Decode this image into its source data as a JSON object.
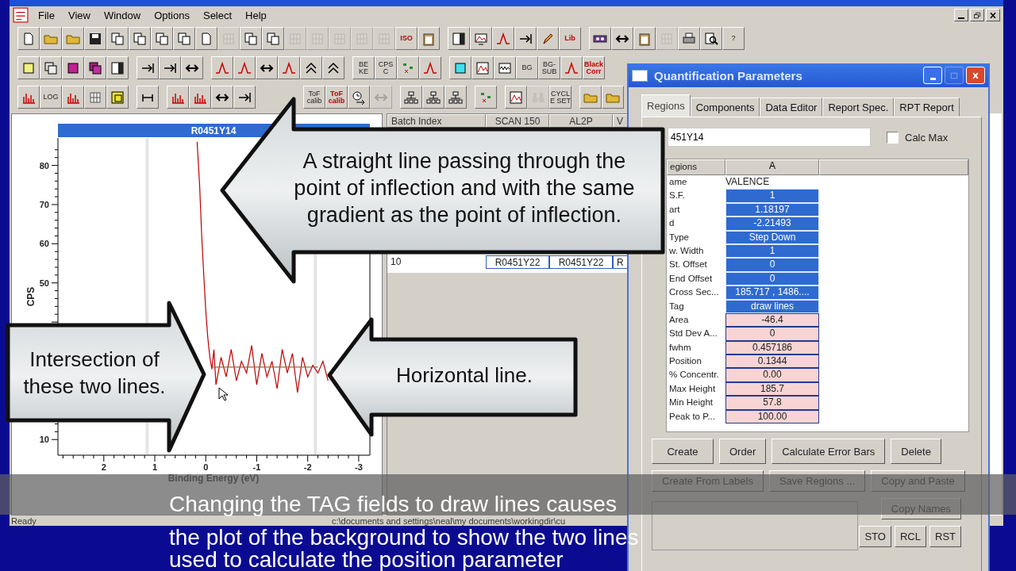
{
  "menu_bar": {
    "items": [
      "File",
      "View",
      "Window",
      "Options",
      "Select",
      "Help"
    ]
  },
  "toolbars": [
    [
      {
        "kind": "icon",
        "disabled": false
      },
      {
        "kind": "icon",
        "disabled": false
      },
      {
        "kind": "icon",
        "disabled": false
      },
      {
        "kind": "icon",
        "disabled": false
      },
      {
        "kind": "icon",
        "disabled": false
      },
      {
        "kind": "icon",
        "disabled": false
      },
      {
        "kind": "icon",
        "disabled": false
      },
      {
        "kind": "icon",
        "disabled": false
      },
      {
        "kind": "icon",
        "disabled": false
      },
      {
        "kind": "icon",
        "disabled": true
      },
      {
        "kind": "icon",
        "disabled": false
      },
      {
        "kind": "icon",
        "disabled": false
      },
      {
        "kind": "icon",
        "disabled": true
      },
      {
        "kind": "icon",
        "disabled": true
      },
      {
        "kind": "icon",
        "disabled": true
      },
      {
        "kind": "icon",
        "disabled": true
      },
      {
        "kind": "icon",
        "disabled": true
      },
      {
        "kind": "redlabel",
        "label": "ISO",
        "disabled": false
      },
      {
        "kind": "icon",
        "disabled": false
      },
      {
        "kind": "gap"
      },
      {
        "kind": "icon",
        "disabled": false
      },
      {
        "kind": "icon",
        "disabled": false
      },
      {
        "kind": "icon",
        "disabled": false
      },
      {
        "kind": "icon",
        "disabled": false
      },
      {
        "kind": "icon",
        "disabled": false
      },
      {
        "kind": "redlabel",
        "label": "Lib",
        "disabled": false
      },
      {
        "kind": "gap"
      },
      {
        "kind": "icon",
        "disabled": false
      },
      {
        "kind": "icon",
        "disabled": false
      },
      {
        "kind": "icon",
        "disabled": false
      },
      {
        "kind": "icon",
        "disabled": true
      },
      {
        "kind": "icon",
        "disabled": false
      },
      {
        "kind": "icon",
        "disabled": false
      },
      {
        "kind": "label",
        "label": "?",
        "disabled": false
      }
    ],
    [
      {
        "kind": "icon",
        "disabled": false
      },
      {
        "kind": "icon",
        "disabled": false
      },
      {
        "kind": "icon",
        "disabled": false
      },
      {
        "kind": "icon",
        "disabled": false
      },
      {
        "kind": "icon",
        "disabled": false
      },
      {
        "kind": "gap"
      },
      {
        "kind": "icon",
        "disabled": false
      },
      {
        "kind": "icon",
        "disabled": false
      },
      {
        "kind": "icon",
        "disabled": false
      },
      {
        "kind": "gap"
      },
      {
        "kind": "icon",
        "disabled": false
      },
      {
        "kind": "icon",
        "disabled": false
      },
      {
        "kind": "icon",
        "disabled": false
      },
      {
        "kind": "icon",
        "disabled": false
      },
      {
        "kind": "icon",
        "disabled": false
      },
      {
        "kind": "icon",
        "disabled": false
      },
      {
        "kind": "gap"
      },
      {
        "kind": "label",
        "label": "BE KE",
        "disabled": false
      },
      {
        "kind": "label",
        "label": "CPS C",
        "disabled": false
      },
      {
        "kind": "icon",
        "disabled": false
      },
      {
        "kind": "icon",
        "disabled": false
      },
      {
        "kind": "gap"
      },
      {
        "kind": "icon",
        "disabled": false
      },
      {
        "kind": "icon",
        "disabled": false
      },
      {
        "kind": "icon",
        "disabled": false
      },
      {
        "kind": "label",
        "label": "BG",
        "disabled": false
      },
      {
        "kind": "label",
        "label": "BG-SUB",
        "disabled": false
      },
      {
        "kind": "icon",
        "disabled": false
      },
      {
        "kind": "redlabel",
        "label": "Black Corr",
        "disabled": false
      }
    ],
    [
      {
        "kind": "icon",
        "disabled": false
      },
      {
        "kind": "label",
        "label": "LOG",
        "disabled": false
      },
      {
        "kind": "icon",
        "disabled": false
      },
      {
        "kind": "icon",
        "disabled": false
      },
      {
        "kind": "icon",
        "disabled": false
      },
      {
        "kind": "gap"
      },
      {
        "kind": "icon",
        "disabled": false
      },
      {
        "kind": "gap"
      },
      {
        "kind": "icon",
        "disabled": false
      },
      {
        "kind": "icon",
        "disabled": false
      },
      {
        "kind": "icon",
        "disabled": false
      },
      {
        "kind": "icon",
        "disabled": false
      },
      {
        "kind": "space"
      },
      {
        "kind": "label",
        "label": "ToF calib",
        "disabled": false
      },
      {
        "kind": "redlabel",
        "label": "ToF calib",
        "disabled": false
      },
      {
        "kind": "icon",
        "disabled": false
      },
      {
        "kind": "icon",
        "disabled": true
      },
      {
        "kind": "gap"
      },
      {
        "kind": "icon",
        "disabled": false
      },
      {
        "kind": "icon",
        "disabled": false
      },
      {
        "kind": "icon",
        "disabled": false
      },
      {
        "kind": "gap"
      },
      {
        "kind": "icon",
        "disabled": false
      },
      {
        "kind": "gap"
      },
      {
        "kind": "icon",
        "disabled": false
      },
      {
        "kind": "icon",
        "disabled": true
      },
      {
        "kind": "label",
        "label": "CYCLE SET",
        "disabled": false
      },
      {
        "kind": "gap"
      },
      {
        "kind": "icon",
        "disabled": false
      },
      {
        "kind": "icon",
        "disabled": false
      }
    ]
  ],
  "plot": {
    "title": "R0451Y14",
    "chart_data": {
      "type": "line",
      "xlabel": "Binding Energy (eV)",
      "ylabel": "CPS",
      "xlim": [
        2.9,
        -3.22
      ],
      "ylim": [
        6,
        87
      ],
      "xticks": [
        2,
        1,
        0,
        -1,
        -2,
        -3
      ],
      "yticks": [
        10,
        50,
        60,
        70,
        80
      ],
      "x": [
        0.17,
        0.12,
        0.08,
        0.04,
        0,
        -0.04,
        -0.08,
        -0.12,
        -0.16,
        -0.2,
        -0.3,
        -0.4,
        -0.5,
        -0.6,
        -0.7,
        -0.8,
        -0.9,
        -1.0,
        -1.1,
        -1.2,
        -1.3,
        -1.4,
        -1.5,
        -1.6,
        -1.7,
        -1.8,
        -1.9,
        -2.0,
        -2.1,
        -2.2,
        -2.3,
        -2.4
      ],
      "series": [
        {
          "color": "#c00000",
          "values": [
            86,
            75,
            62,
            52,
            43,
            36,
            31,
            28,
            33,
            24,
            31,
            26,
            33,
            25,
            30,
            27,
            34,
            24,
            32,
            26,
            30,
            23,
            33,
            27,
            32,
            22,
            31,
            26,
            29,
            27,
            30,
            25
          ]
        },
        {
          "color": "#9a6a3a",
          "values": [
            null,
            null,
            null,
            null,
            null,
            null,
            null,
            28.5,
            28.5,
            28.5,
            28.5,
            28.5,
            28.5,
            28.5,
            28.5,
            28.5,
            28.5,
            28.5,
            28.5,
            28.5,
            28.5,
            28.5,
            28.5,
            28.5,
            28.5,
            28.5,
            28.5,
            28.5,
            28.5,
            28.5,
            null,
            null
          ]
        }
      ],
      "bands": [
        {
          "axis": "x",
          "from": 1.12,
          "to": 1.18
        },
        {
          "axis": "x",
          "from": -2.12,
          "to": -2.18
        }
      ]
    }
  },
  "batch_table": {
    "columns": [
      "Batch Index",
      "SCAN 150",
      "AL2P",
      "V"
    ],
    "rows": [
      [
        "10",
        "R0451Y22",
        "R0451Y22",
        "R"
      ]
    ]
  },
  "status_bar": {
    "message": "Ready",
    "path": "c:\\documents and settings\\neal\\my documents\\workingdir\\cu"
  },
  "dialog": {
    "title": "Quantification Parameters",
    "title_buttons": [
      {
        "kind": "minimize",
        "disabled": false
      },
      {
        "kind": "maximize",
        "disabled": true
      },
      {
        "kind": "close",
        "disabled": false
      }
    ],
    "tabs": [
      {
        "label": "Regions",
        "selected": true
      },
      {
        "label": "Components",
        "selected": false
      },
      {
        "label": "Data Editor",
        "selected": false
      },
      {
        "label": "Report Spec.",
        "selected": false
      },
      {
        "label": "RPT Report",
        "selected": false
      }
    ],
    "name_field": {
      "value": "451Y14"
    },
    "calc_max": {
      "label": "Calc Max",
      "checked": false
    },
    "grid": {
      "columns": [
        "egions",
        "A"
      ],
      "rows": [
        {
          "label": "ame",
          "value": "VALENCE",
          "kind": "text"
        },
        {
          "label": "S.F.",
          "value": "1",
          "kind": "input"
        },
        {
          "label": "art",
          "value": "1.18197",
          "kind": "input"
        },
        {
          "label": "d",
          "value": "-2.21493",
          "kind": "input"
        },
        {
          "label": "Type",
          "value": "Step Down",
          "kind": "input"
        },
        {
          "label": "w. Width",
          "value": "1",
          "kind": "input"
        },
        {
          "label": "St. Offset",
          "value": "0",
          "kind": "input"
        },
        {
          "label": "End Offset",
          "value": "0",
          "kind": "input"
        },
        {
          "label": "Cross Sec...",
          "value": "185.717 , 1486....",
          "kind": "input"
        },
        {
          "label": "Tag",
          "value": "draw lines",
          "kind": "input"
        },
        {
          "label": "Area",
          "value": "-46.4",
          "kind": "result"
        },
        {
          "label": "Std Dev A...",
          "value": "0",
          "kind": "result"
        },
        {
          "label": "fwhm",
          "value": "0.457186",
          "kind": "result"
        },
        {
          "label": "Position",
          "value": "0.1344",
          "kind": "result"
        },
        {
          "label": "% Concentr.",
          "value": "0.00",
          "kind": "result"
        },
        {
          "label": "Max Height",
          "value": "185.7",
          "kind": "result"
        },
        {
          "label": "Min Height",
          "value": "57.8",
          "kind": "result"
        },
        {
          "label": "Peak to P...",
          "value": "100.00",
          "kind": "result"
        }
      ]
    },
    "button_rows": [
      [
        "Create",
        "Order",
        "Calculate Error Bars",
        "Delete"
      ],
      [
        "Create From Labels",
        "Save Regions ...",
        "Copy and Paste"
      ]
    ],
    "copy_names": "Copy Names",
    "memory_buttons": [
      "STO",
      "RCL",
      "RST"
    ]
  },
  "callouts": [
    {
      "kind": "left",
      "text": "A straight line passing through the point of inflection and with the same gradient as the point of inflection."
    },
    {
      "kind": "right",
      "text": "Intersection of these two lines."
    },
    {
      "kind": "left",
      "text": "Horizontal line."
    }
  ],
  "caption": {
    "lines": [
      "Changing the TAG fields to draw lines causes",
      "the plot of the background to show the two lines",
      "used to calculate the position parameter"
    ]
  }
}
